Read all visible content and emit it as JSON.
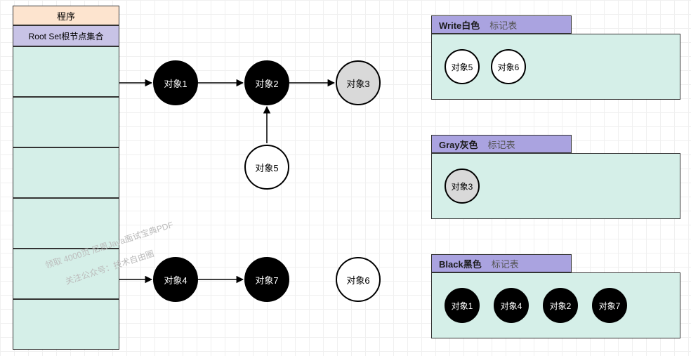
{
  "left": {
    "title": "程序",
    "rootset": "Root Set根节点集合"
  },
  "nodes": {
    "n1": "对象1",
    "n2": "对象2",
    "n3": "对象3",
    "n4": "对象4",
    "n5": "对象5",
    "n6": "对象6",
    "n7": "对象7"
  },
  "panels": {
    "white": {
      "title": "Write白色",
      "sub": "标记表",
      "items": [
        "对象5",
        "对象6"
      ]
    },
    "gray": {
      "title": "Gray灰色",
      "sub": "标记表",
      "items": [
        "对象3"
      ]
    },
    "black": {
      "title": "Black黑色",
      "sub": "标记表",
      "items": [
        "对象1",
        "对象4",
        "对象2",
        "对象7"
      ]
    }
  },
  "watermark": {
    "l1": "领取 4000页 尼恩Java面试宝典PDF",
    "l2": "关注公众号：技术自由圈"
  }
}
